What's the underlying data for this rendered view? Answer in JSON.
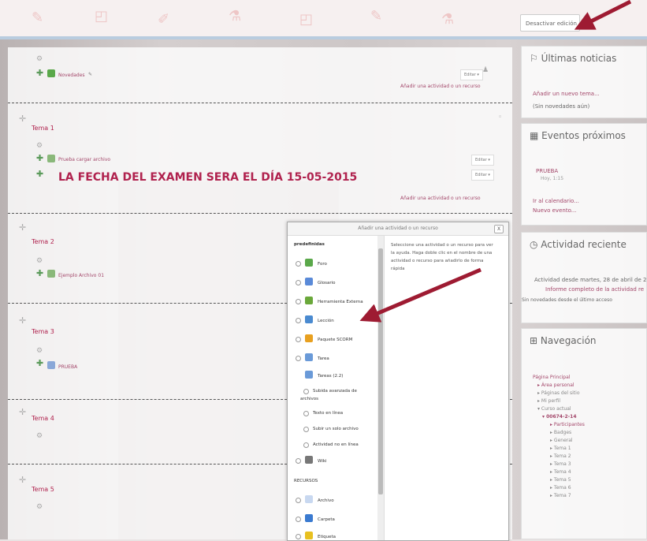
{
  "header": {
    "deactivate_edit_button": "Desactivar edición"
  },
  "main": {
    "section0": {
      "activity_label": "Novedades",
      "edit_label": "Editar ▾",
      "add_link": "Añadir una actividad o un recurso"
    },
    "tema1": {
      "title": "Tema 1",
      "activity_label": "Prueba cargar archivo",
      "edit_label_1": "Editar ▾",
      "edit_label_2": "Editar ▾",
      "big_label": "LA FECHA DEL EXAMEN SERA EL DÍA 15-05-2015",
      "add_link": "Añadir una actividad o un recurso"
    },
    "tema2": {
      "title": "Tema 2",
      "activity_label": "Ejemplo Archivo 01"
    },
    "tema3": {
      "title": "Tema 3",
      "activity_label": "PRUEBA"
    },
    "tema4": {
      "title": "Tema 4"
    },
    "tema5": {
      "title": "Tema 5"
    }
  },
  "modal": {
    "title": "Añadir una actividad o un recurso",
    "close": "X",
    "group_predef": "predefinidas",
    "items": [
      {
        "label": "Foro",
        "color": "#5aa84a"
      },
      {
        "label": "Glosario",
        "color": "#5a8ad8"
      },
      {
        "label": "Herramienta Externa",
        "color": "#6aa83a"
      },
      {
        "label": "Lección",
        "color": "#4a8ad0"
      },
      {
        "label": "Paquete SCORM",
        "color": "#e8a020"
      },
      {
        "label": "Tarea",
        "color": "#6a9ad8"
      },
      {
        "label": "Tareas (2.2)",
        "color": "#6a9ad8"
      }
    ],
    "subitems": [
      "Subida avanzada de",
      "archivos",
      "Texto en línea",
      "Subir un solo archivo",
      "Actividad no en línea"
    ],
    "wiki": "Wiki",
    "group_recursos": "RECURSOS",
    "recursos": [
      {
        "label": "Archivo",
        "color": "#5a8ad8"
      },
      {
        "label": "Carpeta",
        "color": "#3a7ad0"
      },
      {
        "label": "Etiqueta",
        "color": "#e8c020"
      }
    ],
    "description": "Seleccione una actividad o un recurso para ver la ayuda. Haga doble clic en el nombre de una actividad o recurso para añadirlo de forma rápida"
  },
  "sidebar": {
    "news": {
      "title": "Últimas noticias",
      "add_link": "Añadir un nuevo tema...",
      "empty": "(Sin novedades aún)"
    },
    "events": {
      "title": "Eventos próximos",
      "event_name": "PRUEBA",
      "event_time": "Hoy, 1:15",
      "calendar_link": "Ir al calendario...",
      "new_event_link": "Nuevo evento..."
    },
    "activity": {
      "title": "Actividad reciente",
      "since": "Actividad desde martes, 28 de abril de 2",
      "full_report": "Informe completo de la actividad re",
      "no_news": "Sin novedades desde el último acceso"
    },
    "nav": {
      "title": "Navegación",
      "items": [
        "Página Principal",
        "Área personal",
        "Páginas del sitio",
        "Mi perfil",
        "Curso actual",
        "00674-2-14",
        "Participantes",
        "Badges",
        "General",
        "Tema 1",
        "Tema 2",
        "Tema 3",
        "Tema 4",
        "Tema 5",
        "Tema 6",
        "Tema 7"
      ]
    }
  },
  "colors": {
    "accent": "#b0224e",
    "link": "#a3476a",
    "arrow": "#9e1b32"
  }
}
